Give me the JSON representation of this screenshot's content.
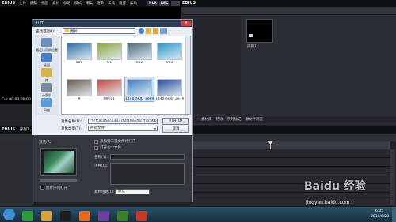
{
  "app": {
    "player_title": "EDIUS",
    "menu": [
      "文件",
      "编辑",
      "视图",
      "素材",
      "标记",
      "模式",
      "采集",
      "渲染",
      "工具",
      "设置",
      "帮助"
    ],
    "plr_label": "PLR",
    "rec_label": "REC",
    "bin_title": "EDIUS",
    "bin_tabs": [
      "素材库",
      "特效",
      "序列标记",
      "源文件浏览"
    ],
    "bin_clip_label": "序列1",
    "timeline_title": "EDIUS",
    "timeline_sequence": "序列1",
    "timecode": "Cur 00:00:00:00"
  },
  "dialog": {
    "title": "打开",
    "lookin_label": "查找范围(I):",
    "lookin_value": "图片",
    "places": [
      {
        "label": "最近访问的位置",
        "icon": "recent-places-icon",
        "color": "#6b8fb8"
      },
      {
        "label": "桌面",
        "icon": "desktop-icon",
        "color": "#4a7fc1"
      },
      {
        "label": "库",
        "icon": "libraries-icon",
        "color": "#d8b24c"
      },
      {
        "label": "计算机",
        "icon": "computer-icon",
        "color": "#7e8a99"
      },
      {
        "label": "网络",
        "icon": "network-icon",
        "color": "#5b9bd5"
      }
    ],
    "files": [
      {
        "name": "000",
        "color": "#2f6fa8"
      },
      {
        "name": "01",
        "color": "#8fa83a"
      },
      {
        "name": "002",
        "color": "#4f6b7a"
      },
      {
        "name": "003",
        "color": "#2a9ac9"
      },
      {
        "name": "9",
        "color": "#6b5a4a"
      },
      {
        "name": "09011",
        "color": "#c9453a"
      },
      {
        "name": "1440x900_3ed9f3d...",
        "color": "#3b7fc4"
      },
      {
        "name": "1440x900_2e7e...",
        "color": "#2a4d9c"
      }
    ],
    "filename_label": "对象名称(N):",
    "filename_value": "\"f7fcaca5ecb3337f2f10e6f8c7fdcb6b8f...",
    "filetype_label": "对象类型(T):",
    "filetype_value": "所有文件",
    "open_label": "打开(O)",
    "cancel_label": "取消",
    "preview_label": "预览(R)",
    "check_add_project": "添加到工程文件并打开",
    "check_option": "打开多个文件",
    "name_label": "名称(Y):",
    "comment_label": "注释(C):",
    "reel_label": "素材线路(L):",
    "reel_value": "默认",
    "check_sequence": "图片序列打开"
  },
  "tray": {
    "time": "6:05",
    "date": "2018/6/20"
  },
  "watermark": {
    "main": "Baidu 经验",
    "url": "jingyan.baidu.com"
  },
  "taskbar_icons": [
    {
      "name": "start-orb-icon",
      "color": "#3d8fd6"
    },
    {
      "name": "media-player-icon",
      "color": "#2f9a3c"
    },
    {
      "name": "explorer-icon",
      "color": "#d7a43a"
    },
    {
      "name": "qq-icon",
      "color": "#1d1d1d"
    },
    {
      "name": "firefox-icon",
      "color": "#e66b1e"
    },
    {
      "name": "video-app-icon",
      "color": "#6c3fa3"
    },
    {
      "name": "edius-icon",
      "color": "#3b7f2a"
    },
    {
      "name": "flag-icon",
      "color": "#c33a2a"
    }
  ]
}
